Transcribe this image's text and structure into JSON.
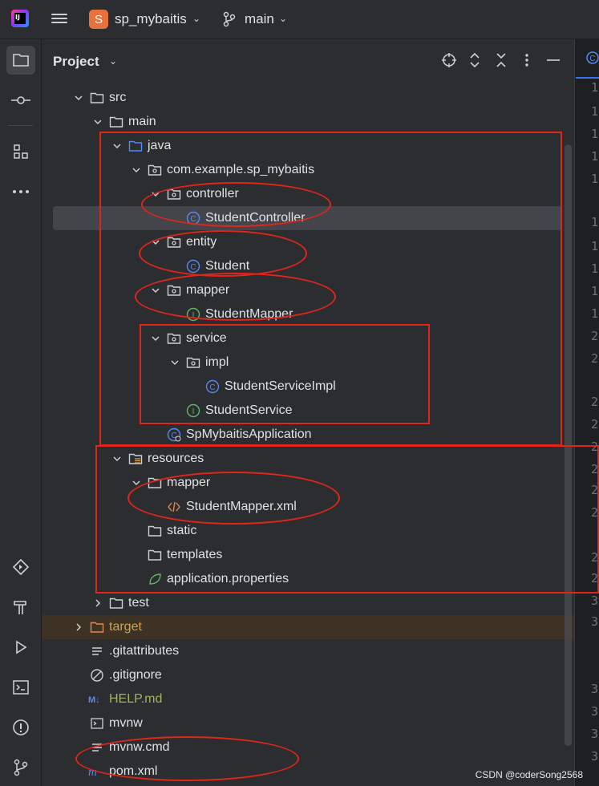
{
  "topbar": {
    "project_badge": "S",
    "project_name": "sp_mybaitis",
    "branch_name": "main"
  },
  "panel": {
    "title": "Project"
  },
  "tree": [
    {
      "label": "src",
      "type": "folder",
      "expanded": true
    },
    {
      "label": "main",
      "type": "folder",
      "expanded": true
    },
    {
      "label": "java",
      "type": "source-folder",
      "expanded": true
    },
    {
      "label": "com.example.sp_mybaitis",
      "type": "package",
      "expanded": true
    },
    {
      "label": "controller",
      "type": "package",
      "expanded": true
    },
    {
      "label": "StudentController",
      "type": "class",
      "selected": true
    },
    {
      "label": "entity",
      "type": "package",
      "expanded": true
    },
    {
      "label": "Student",
      "type": "class"
    },
    {
      "label": "mapper",
      "type": "package",
      "expanded": true
    },
    {
      "label": "StudentMapper",
      "type": "interface"
    },
    {
      "label": "service",
      "type": "package",
      "expanded": true
    },
    {
      "label": "impl",
      "type": "package",
      "expanded": true
    },
    {
      "label": "StudentServiceImpl",
      "type": "class"
    },
    {
      "label": "StudentService",
      "type": "interface"
    },
    {
      "label": "SpMybaitisApplication",
      "type": "spring-class"
    },
    {
      "label": "resources",
      "type": "resources-folder",
      "expanded": true
    },
    {
      "label": "mapper",
      "type": "folder",
      "expanded": true
    },
    {
      "label": "StudentMapper.xml",
      "type": "xml"
    },
    {
      "label": "static",
      "type": "folder"
    },
    {
      "label": "templates",
      "type": "folder"
    },
    {
      "label": "application.properties",
      "type": "properties"
    },
    {
      "label": "test",
      "type": "folder",
      "expanded": false
    },
    {
      "label": "target",
      "type": "excluded-folder",
      "expanded": false
    },
    {
      "label": ".gitattributes",
      "type": "text"
    },
    {
      "label": ".gitignore",
      "type": "ignore"
    },
    {
      "label": "HELP.md",
      "type": "markdown"
    },
    {
      "label": "mvnw",
      "type": "shell"
    },
    {
      "label": "mvnw.cmd",
      "type": "text"
    },
    {
      "label": "pom.xml",
      "type": "maven"
    }
  ],
  "editor": {
    "line_numbers": [
      "1",
      "1",
      "1",
      "1",
      "1",
      "1",
      "1",
      "1",
      "1",
      "1",
      "2",
      "2",
      "2",
      "2",
      "2",
      "2",
      "2",
      "2",
      "2",
      "2",
      "3",
      "3",
      "3",
      "3",
      "3",
      "3",
      "3"
    ]
  },
  "watermark": "CSDN @coderSong2568",
  "colors": {
    "background": "#2b2d30",
    "selection": "#43454a",
    "annotation": "#e0251b",
    "accent": "#3574f0"
  }
}
